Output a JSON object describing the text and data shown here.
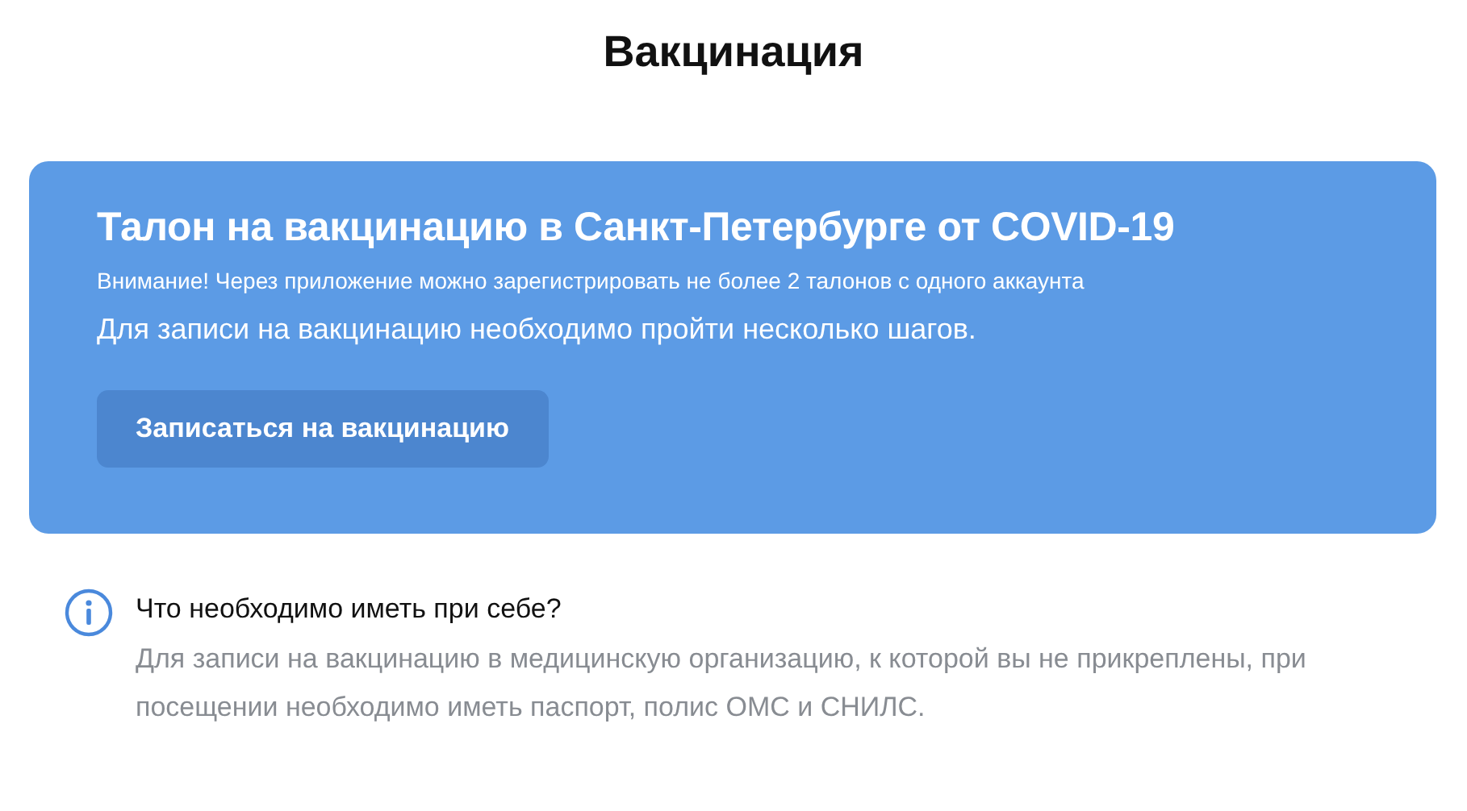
{
  "page_title": "Вакцинация",
  "banner": {
    "title": "Талон на вакцинацию в Санкт-Петербурге от COVID-19",
    "warning": "Внимание! Через приложение можно зарегистрировать не более 2 талонов с одного аккаунта",
    "description": "Для записи на вакцинацию необходимо пройти несколько шагов.",
    "button": "Записаться на вакцинацию"
  },
  "info": {
    "title": "Что необходимо иметь при себе?",
    "text": "Для записи на вакцинацию в медицинскую организацию, к которой вы не прикреплены, при посещении необходимо иметь паспорт, полис ОМС и СНИЛС."
  }
}
